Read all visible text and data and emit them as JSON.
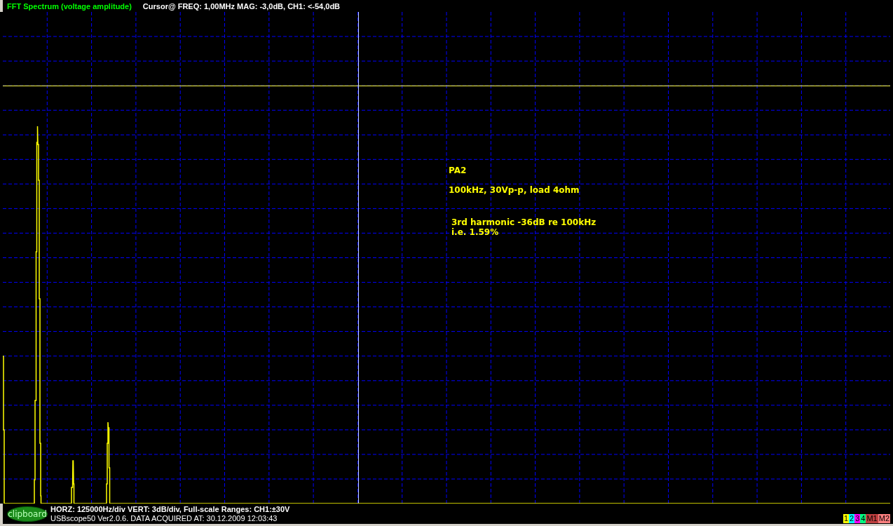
{
  "header": {
    "title": "FFT Spectrum (voltage amplitude)",
    "cursor_readout": "Cursor@ FREQ: 1,00MHz MAG: -3,0dB, CH1: <-54,0dB"
  },
  "plot": {
    "annotations": [
      {
        "text": "PA2"
      },
      {
        "text": "100kHz, 30Vp-p, load 4ohm"
      },
      {
        "text": "3rd harmonic -36dB re 100kHz"
      },
      {
        "text": "i.e. 1.59%"
      }
    ]
  },
  "footer": {
    "clipboard_button": "clipboard",
    "settings_line": "HORZ: 125000Hz/div VERT: 3dB/div, Full-scale Ranges:  CH1:±30V",
    "status_line": "USBscope50 Ver2.0.6.  DATA ACQUIRED AT: 30.12.2009 12:03:43",
    "channels": [
      {
        "label": "1",
        "color": "#ffff00"
      },
      {
        "label": "2",
        "color": "#00ffff"
      },
      {
        "label": "3",
        "color": "#ff00ff"
      },
      {
        "label": "4",
        "color": "#00ff80"
      },
      {
        "label": "M1",
        "color": "#c04040"
      },
      {
        "label": "M2",
        "color": "#ff8080"
      }
    ]
  }
}
